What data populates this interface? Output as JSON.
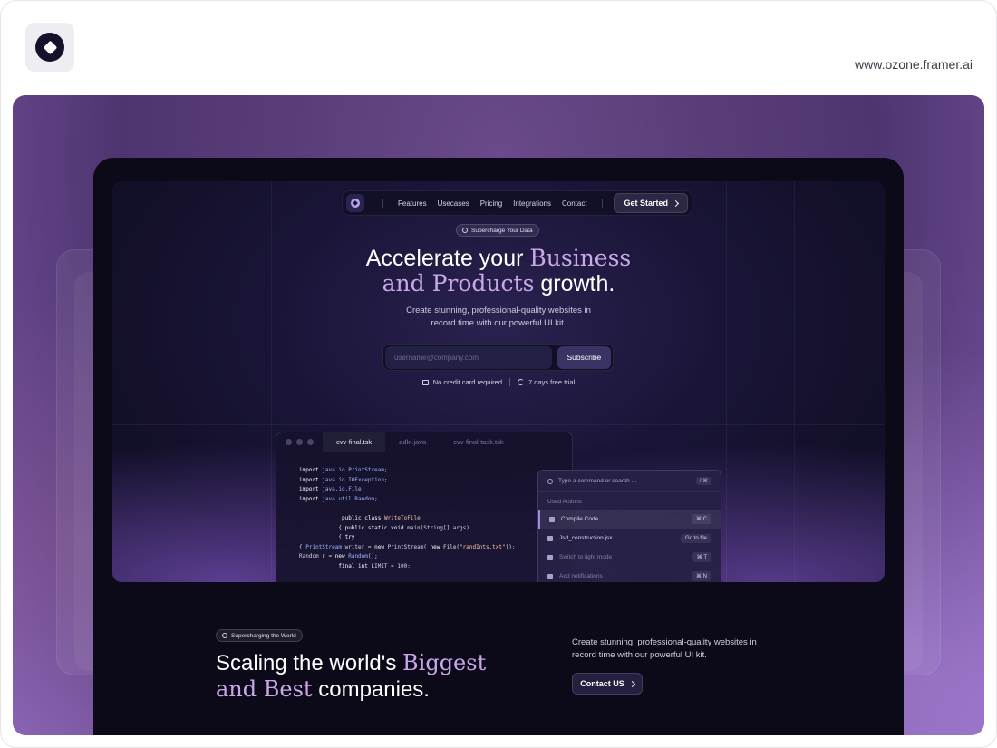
{
  "site_url": "www.ozone.framer.ai",
  "nav": {
    "links": [
      "Features",
      "Usecases",
      "Pricing",
      "Integrations",
      "Contact"
    ],
    "cta": "Get Started"
  },
  "hero": {
    "badge": "Supercharge Your Data",
    "title_plain_1": "Accelerate your ",
    "title_accent_1": "Business",
    "title_accent_2": "and Products",
    "title_plain_2": " growth.",
    "subtitle_line1": "Create stunning, professional-quality websites in",
    "subtitle_line2": "record time with our powerful UI kit.",
    "email_placeholder": "username@company.com",
    "subscribe_label": "Subscribe",
    "perk_1": "No credit card required",
    "perk_2": "7 days free trial"
  },
  "editor": {
    "tabs": [
      "cvv-final.tsk",
      "adkt.java",
      "cvv-final-task.tsk"
    ]
  },
  "palette": {
    "search_placeholder": "Type a command or search ...",
    "search_kbd": "/ ⌘",
    "section_label": "Used Actions",
    "items": [
      {
        "label": "Compile Code ...",
        "kbd": "⌘ C"
      },
      {
        "label": "Jsd_construction.jsx",
        "kbd": "Go to file"
      },
      {
        "label": "Switch to light mode",
        "kbd": "⌘ T"
      },
      {
        "label": "Add notifications",
        "kbd": "⌘ N"
      }
    ]
  },
  "lower": {
    "badge": "Supercharging the World",
    "title_plain_1": "Scaling the world's ",
    "title_accent_1": "Biggest",
    "title_accent_2": "and Best",
    "title_plain_2": " companies.",
    "text": "Create stunning, professional-quality websites in record time with our powerful UI kit.",
    "contact_label": "Contact US"
  },
  "colors": {
    "accent_serif": "#c9a8ea",
    "device_bg": "#0c0a18",
    "stage_purple": "#5a3d78"
  }
}
